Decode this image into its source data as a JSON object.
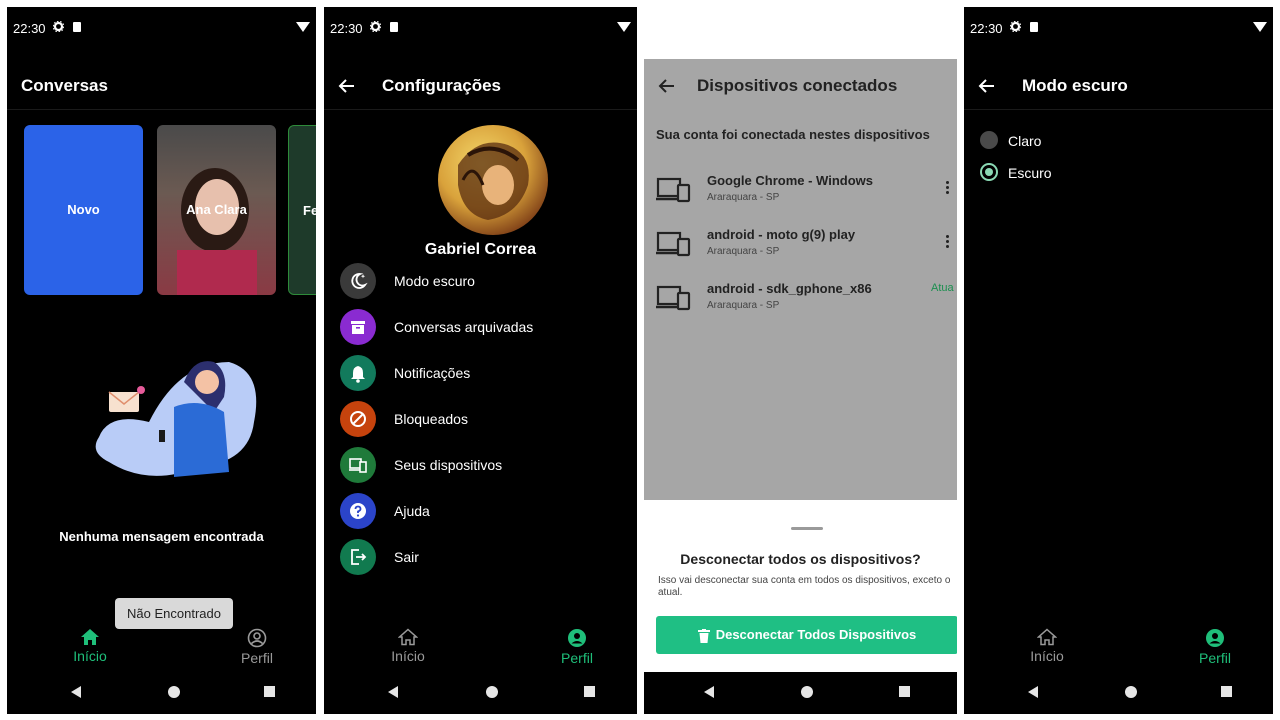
{
  "status": {
    "time": "22:30"
  },
  "colors": {
    "accent": "#1fbf7a",
    "background": "#000000",
    "new_story": "#2b63e8",
    "disconnect_button": "#1fbf84"
  },
  "phone1": {
    "title": "Conversas",
    "stories": [
      {
        "label": "Novo"
      },
      {
        "label": "Ana Clara"
      },
      {
        "label": "Fe"
      }
    ],
    "empty_message": "Nenhuma mensagem encontrada",
    "toast": "Não Encontrado",
    "nav": {
      "home": "Início",
      "profile": "Perfil",
      "active": "home"
    }
  },
  "phone2": {
    "title": "Configurações",
    "profile_name": "Gabriel Correa",
    "menu": [
      {
        "label": "Modo escuro",
        "icon": "moon-stars-icon",
        "color": "#3a3a3a"
      },
      {
        "label": "Conversas arquivadas",
        "icon": "archive-icon",
        "color": "#8a2bd1"
      },
      {
        "label": "Notificações",
        "icon": "bell-icon",
        "color": "#127a5c"
      },
      {
        "label": "Bloqueados",
        "icon": "block-icon",
        "color": "#c6430d"
      },
      {
        "label": "Seus dispositivos",
        "icon": "devices-icon",
        "color": "#1f7a3a"
      },
      {
        "label": "Ajuda",
        "icon": "help-icon",
        "color": "#2b44c9"
      },
      {
        "label": "Sair",
        "icon": "logout-icon",
        "color": "#117a4f"
      }
    ],
    "nav": {
      "home": "Início",
      "profile": "Perfil",
      "active": "profile"
    }
  },
  "phone3": {
    "title": "Dispositivos conectados",
    "subtitle": "Sua conta foi conectada nestes dispositivos",
    "devices": [
      {
        "name": "Google Chrome - Windows",
        "location": "Araraquara - SP",
        "badge": ""
      },
      {
        "name": "android - moto g(9) play",
        "location": "Araraquara - SP",
        "badge": ""
      },
      {
        "name": "android - sdk_gphone_x86",
        "location": "Araraquara - SP",
        "badge": "Atua"
      }
    ],
    "sheet": {
      "title": "Desconectar todos os dispositivos?",
      "description": "Isso vai desconectar sua conta em todos os dispositivos, exceto o atual.",
      "button": "Desconectar Todos Dispositivos"
    }
  },
  "phone4": {
    "title": "Modo escuro",
    "options": [
      {
        "label": "Claro",
        "selected": false
      },
      {
        "label": "Escuro",
        "selected": true
      }
    ],
    "nav": {
      "home": "Início",
      "profile": "Perfil",
      "active": "profile"
    }
  }
}
